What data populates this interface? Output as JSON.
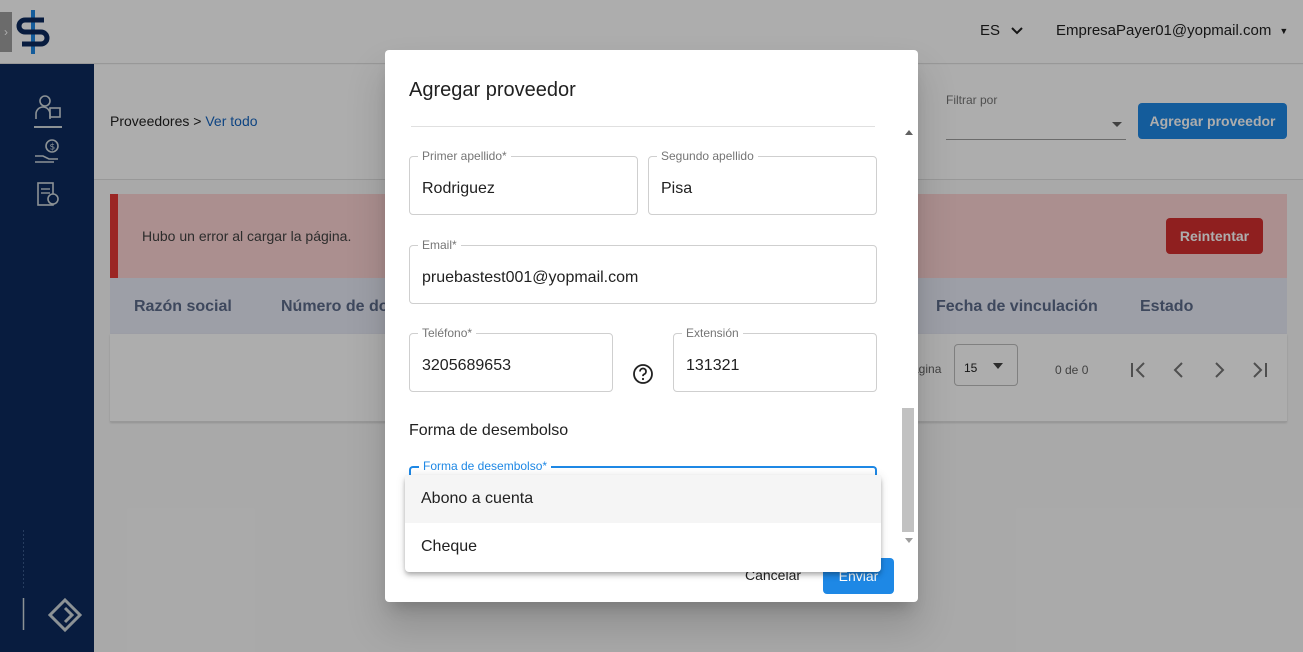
{
  "header": {
    "language": "ES",
    "user_email": "EmpresaPayer01@yopmail.com"
  },
  "sidebar": {
    "items": [
      {
        "icon": "supplier-icon",
        "active": true
      },
      {
        "icon": "payment-hand-icon",
        "active": false
      },
      {
        "icon": "invoice-icon",
        "active": false
      }
    ]
  },
  "page": {
    "breadcrumb_root": "Proveedores",
    "breadcrumb_sep": " > ",
    "breadcrumb_link": "Ver todo",
    "filter_label": "Filtrar por",
    "add_button": "Agregar proveedor"
  },
  "error": {
    "message": "Hubo un error al cargar la página.",
    "retry_label": "Reintentar"
  },
  "table": {
    "columns": [
      "Razón social",
      "Número de doc",
      "Fecha de vinculación",
      "Estado"
    ]
  },
  "pagination": {
    "per_page_label": "ágina",
    "per_page_value": "15",
    "count_label": "0 de 0"
  },
  "dialog": {
    "title": "Agregar proveedor",
    "fields": {
      "first_lastname": {
        "label": "Primer apellido*",
        "value": "Rodriguez"
      },
      "second_lastname": {
        "label": "Segundo apellido",
        "value": "Pisa"
      },
      "email": {
        "label": "Email*",
        "value": "pruebastest001@yopmail.com"
      },
      "phone": {
        "label": "Teléfono*",
        "value": "3205689653"
      },
      "extension": {
        "label": "Extensión",
        "value": "131321"
      }
    },
    "section_title": "Forma de desembolso",
    "payment_field_label": "Forma de desembolso*",
    "payment_options": [
      "Abono a cuenta",
      "Cheque"
    ],
    "cancel_label": "Cancelar",
    "send_label": "Enviar"
  },
  "colors": {
    "sidebar": "#0d2a5e",
    "primary": "#1e88e5",
    "error_bg": "#fdd3d3",
    "error_button": "#d32f2f"
  }
}
